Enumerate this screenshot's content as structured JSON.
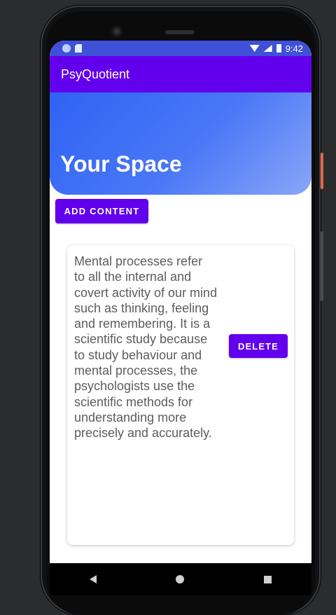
{
  "status_bar": {
    "time": "9:42"
  },
  "app_bar": {
    "title": "PsyQuotient"
  },
  "hero": {
    "title": "Your Space"
  },
  "actions": {
    "add_content_label": "ADD CONTENT"
  },
  "card": {
    "text": "Mental processes refer\nto all the internal and\ncovert activity of our mind\nsuch as thinking, feeling\nand remembering. It is a\nscientific study because\nto study behaviour and\nmental processes, the\npsychologists use the\nscientific methods for\nunderstanding more\nprecisely and accurately.",
    "delete_label": "DELETE"
  },
  "colors": {
    "primary": "#6200ee",
    "status_bar": "#3f51d8",
    "hero_gradient_start": "#2f62f4",
    "hero_gradient_end": "#8aa6f8",
    "body_text": "#5c5c5c"
  },
  "icons": [
    "wifi-icon",
    "signal-icon",
    "battery-icon",
    "back-icon",
    "home-icon",
    "recents-icon"
  ]
}
